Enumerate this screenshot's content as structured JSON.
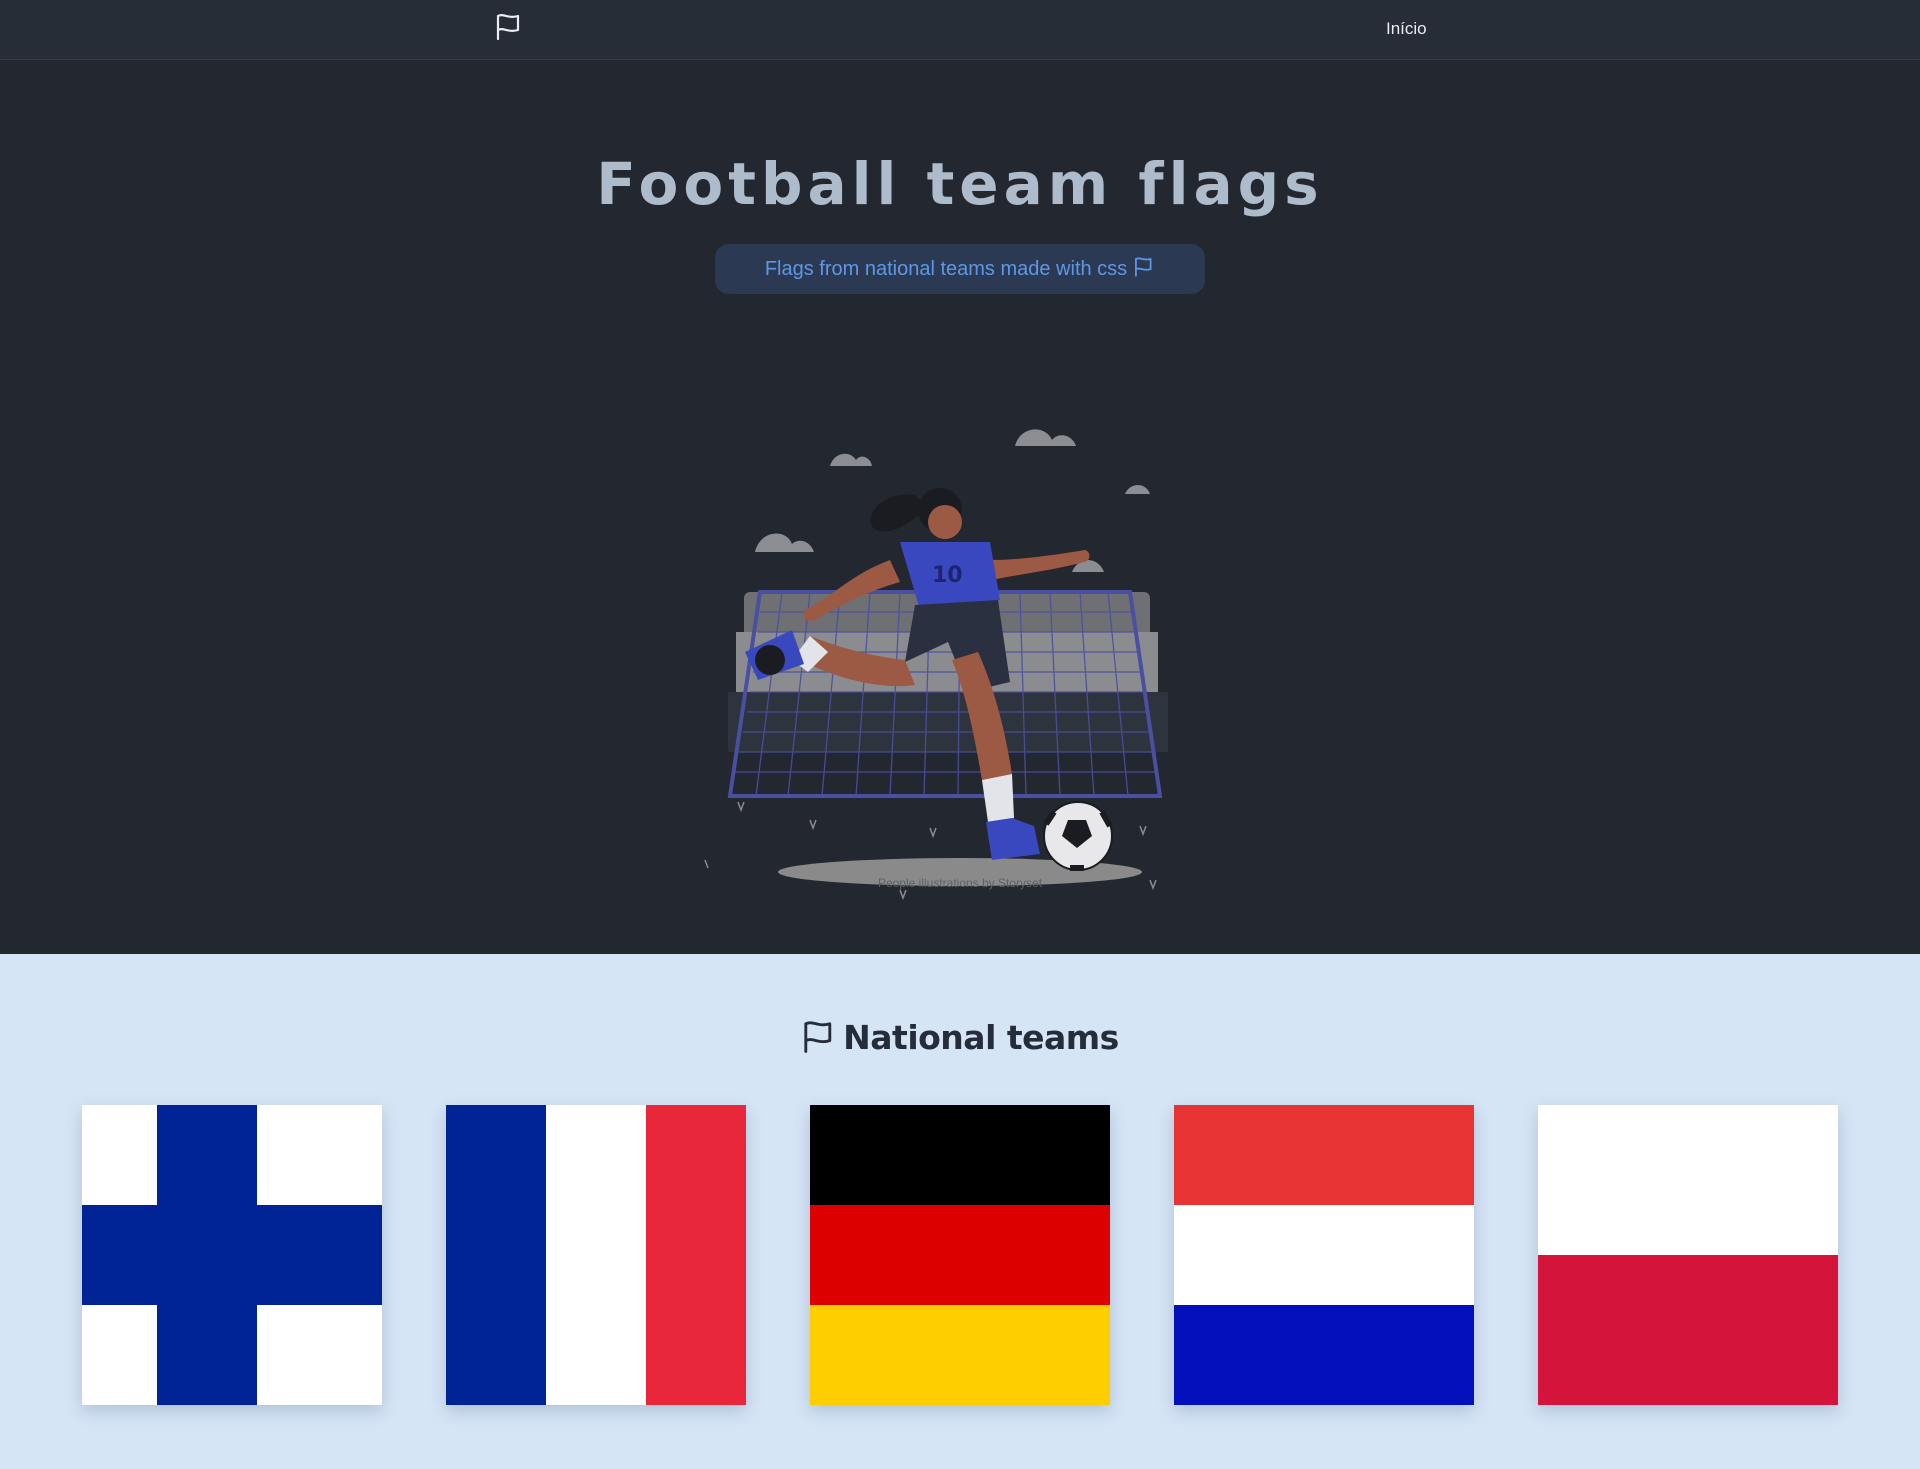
{
  "navbar": {
    "logo_icon": "flag-icon",
    "link_inicio": "Início"
  },
  "hero": {
    "title": "Football team flags",
    "badge_text": "Flags from national teams made with css",
    "badge_icon": "flag-icon",
    "illustration": "woman-kicking-football-icon",
    "credit": "People illustrations by Storyset"
  },
  "section": {
    "title": "National teams",
    "title_icon": "flag-icon",
    "flags": [
      {
        "country": "finland",
        "colors": [
          "#ffffff",
          "#002395"
        ]
      },
      {
        "country": "france",
        "colors": [
          "#002395",
          "#ffffff",
          "#e8283a"
        ]
      },
      {
        "country": "germany",
        "colors": [
          "#000000",
          "#dd0000",
          "#ffce00"
        ]
      },
      {
        "country": "netherlands",
        "colors": [
          "#e83335",
          "#ffffff",
          "#0310bb"
        ]
      },
      {
        "country": "poland",
        "colors": [
          "#ffffff",
          "#d4143a"
        ]
      }
    ]
  }
}
